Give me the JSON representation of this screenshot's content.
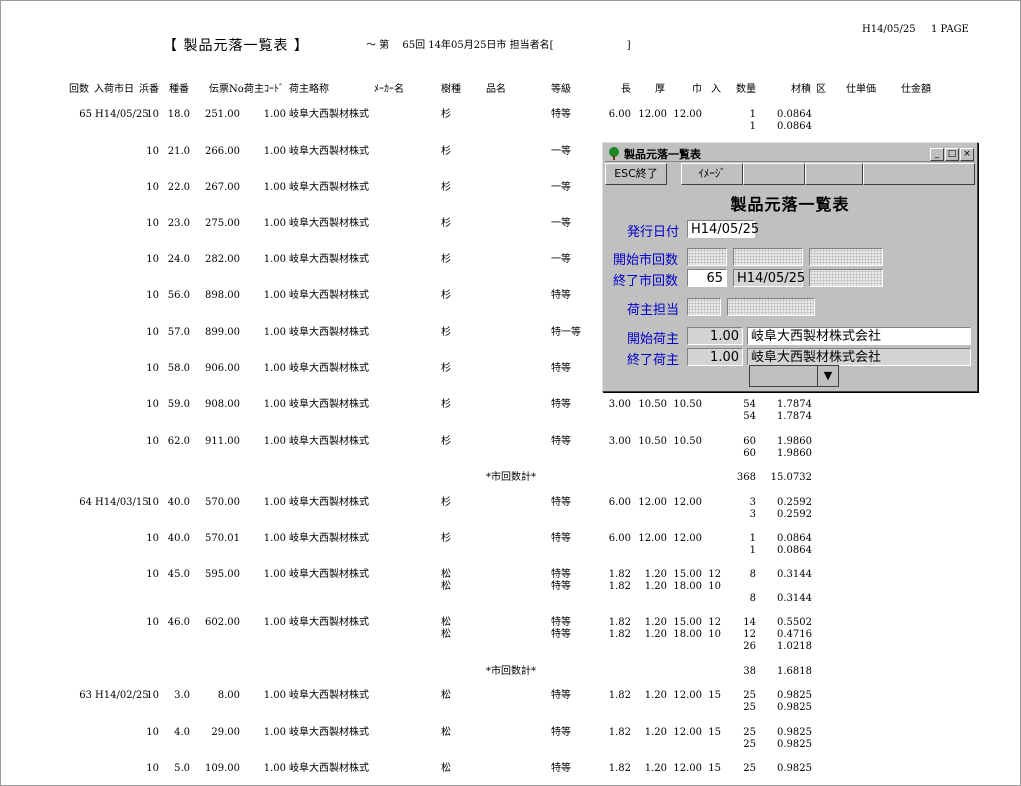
{
  "report": {
    "title": "【 製品元落一覧表 】",
    "header_line": "～ 第　 65回 14年05月25日市 担当者名[　　　　　　　 ]",
    "print_date": "H14/05/25",
    "page": "1 PAGE"
  },
  "columns": {
    "kaisu": "回数",
    "date": "入荷市日",
    "hama": "浜番",
    "shu": "種番",
    "denpyo": "伝票No.",
    "ninushi_cd": "荷主ｺｰﾄﾞ",
    "ninushi": "荷主略称",
    "maker": "ﾒｰｶｰ名",
    "jushu": "樹種",
    "hinmei": "品名",
    "tokyu": "等級",
    "naga": "長",
    "atsu": "厚",
    "haba": "巾",
    "iri": "入",
    "suryo": "数量",
    "zaiseki": "材積",
    "ku": "区",
    "tanka": "仕単価",
    "kingaku": "仕金額"
  },
  "rows": [
    {
      "kai": "65",
      "date": "H14/05/25",
      "hama": "10",
      "shu": "18.0",
      "den": "251.00",
      "cd": "1.00",
      "nin": "岐阜大西製材株式",
      "jushu": "杉",
      "tokyu": "特等",
      "naga": "6.00",
      "atsu": "12.00",
      "haba": "12.00",
      "iri": "",
      "sur": "1",
      "zai": "0.0864",
      "sur2": "1",
      "zai2": "0.0864"
    },
    {
      "kai": "",
      "date": "",
      "hama": "10",
      "shu": "21.0",
      "den": "266.00",
      "cd": "1.00",
      "nin": "岐阜大西製材株式",
      "jushu": "杉",
      "tokyu": "一等",
      "naga": "",
      "atsu": "",
      "haba": "",
      "iri": "",
      "sur": "",
      "zai": "",
      "sur2": "",
      "zai2": ""
    },
    {
      "kai": "",
      "date": "",
      "hama": "10",
      "shu": "22.0",
      "den": "267.00",
      "cd": "1.00",
      "nin": "岐阜大西製材株式",
      "jushu": "杉",
      "tokyu": "一等",
      "naga": "",
      "atsu": "",
      "haba": "",
      "iri": "",
      "sur": "",
      "zai": "",
      "sur2": "",
      "zai2": ""
    },
    {
      "kai": "",
      "date": "",
      "hama": "10",
      "shu": "23.0",
      "den": "275.00",
      "cd": "1.00",
      "nin": "岐阜大西製材株式",
      "jushu": "杉",
      "tokyu": "一等",
      "naga": "",
      "atsu": "",
      "haba": "",
      "iri": "",
      "sur": "",
      "zai": "",
      "sur2": "",
      "zai2": ""
    },
    {
      "kai": "",
      "date": "",
      "hama": "10",
      "shu": "24.0",
      "den": "282.00",
      "cd": "1.00",
      "nin": "岐阜大西製材株式",
      "jushu": "杉",
      "tokyu": "一等",
      "naga": "",
      "atsu": "",
      "haba": "",
      "iri": "",
      "sur": "",
      "zai": "",
      "sur2": "",
      "zai2": ""
    },
    {
      "kai": "",
      "date": "",
      "hama": "10",
      "shu": "56.0",
      "den": "898.00",
      "cd": "1.00",
      "nin": "岐阜大西製材株式",
      "jushu": "杉",
      "tokyu": "特等",
      "naga": "",
      "atsu": "",
      "haba": "",
      "iri": "",
      "sur": "",
      "zai": "",
      "sur2": "",
      "zai2": ""
    },
    {
      "kai": "",
      "date": "",
      "hama": "10",
      "shu": "57.0",
      "den": "899.00",
      "cd": "1.00",
      "nin": "岐阜大西製材株式",
      "jushu": "杉",
      "tokyu": "特一等",
      "naga": "",
      "atsu": "",
      "haba": "",
      "iri": "",
      "sur": "",
      "zai": "",
      "sur2": "",
      "zai2": ""
    },
    {
      "kai": "",
      "date": "",
      "hama": "10",
      "shu": "58.0",
      "den": "906.00",
      "cd": "1.00",
      "nin": "岐阜大西製材株式",
      "jushu": "杉",
      "tokyu": "特等",
      "naga": "",
      "atsu": "",
      "haba": "",
      "iri": "",
      "sur": "",
      "zai": "",
      "sur2": "",
      "zai2": ""
    },
    {
      "kai": "",
      "date": "",
      "hama": "10",
      "shu": "59.0",
      "den": "908.00",
      "cd": "1.00",
      "nin": "岐阜大西製材株式",
      "jushu": "杉",
      "tokyu": "特等",
      "naga": "3.00",
      "atsu": "10.50",
      "haba": "10.50",
      "iri": "",
      "sur": "54",
      "zai": "1.7874",
      "sur2": "54",
      "zai2": "1.7874"
    },
    {
      "kai": "",
      "date": "",
      "hama": "10",
      "shu": "62.0",
      "den": "911.00",
      "cd": "1.00",
      "nin": "岐阜大西製材株式",
      "jushu": "杉",
      "tokyu": "特等",
      "naga": "3.00",
      "atsu": "10.50",
      "haba": "10.50",
      "iri": "",
      "sur": "60",
      "zai": "1.9860",
      "sur2": "60",
      "zai2": "1.9860"
    },
    {
      "kai": "64",
      "date": "H14/03/15",
      "hama": "10",
      "shu": "40.0",
      "den": "570.00",
      "cd": "1.00",
      "nin": "岐阜大西製材株式",
      "jushu": "杉",
      "tokyu": "特等",
      "naga": "6.00",
      "atsu": "12.00",
      "haba": "12.00",
      "iri": "",
      "sur": "3",
      "zai": "0.2592",
      "sur2": "3",
      "zai2": "0.2592"
    },
    {
      "kai": "",
      "date": "",
      "hama": "10",
      "shu": "40.0",
      "den": "570.01",
      "cd": "1.00",
      "nin": "岐阜大西製材株式",
      "jushu": "杉",
      "tokyu": "特等",
      "naga": "6.00",
      "atsu": "12.00",
      "haba": "12.00",
      "iri": "",
      "sur": "1",
      "zai": "0.0864",
      "sur2": "1",
      "zai2": "0.0864"
    },
    {
      "kai": "",
      "date": "",
      "hama": "10",
      "shu": "45.0",
      "den": "595.00",
      "cd": "1.00",
      "nin": "岐阜大西製材株式",
      "jushu": "松",
      "tokyu": "特等",
      "naga": "1.82",
      "atsu": "1.20",
      "haba": "15.00",
      "iri": "12",
      "sur": "8",
      "zai": "0.3144",
      "sur2": "",
      "zai2": ""
    },
    {
      "kai": "",
      "date": "",
      "hama": "10",
      "shu": "46.0",
      "den": "602.00",
      "cd": "1.00",
      "nin": "岐阜大西製材株式",
      "jushu": "松",
      "tokyu": "特等",
      "naga": "1.82",
      "atsu": "1.20",
      "haba": "15.00",
      "iri": "12",
      "sur": "14",
      "zai": "0.5502",
      "sur2": "",
      "zai2": ""
    },
    {
      "kai": "63",
      "date": "H14/02/25",
      "hama": "10",
      "shu": "3.0",
      "den": "8.00",
      "cd": "1.00",
      "nin": "岐阜大西製材株式",
      "jushu": "松",
      "tokyu": "特等",
      "naga": "1.82",
      "atsu": "1.20",
      "haba": "12.00",
      "iri": "15",
      "sur": "25",
      "zai": "0.9825",
      "sur2": "25",
      "zai2": "0.9825"
    },
    {
      "kai": "",
      "date": "",
      "hama": "10",
      "shu": "4.0",
      "den": "29.00",
      "cd": "1.00",
      "nin": "岐阜大西製材株式",
      "jushu": "松",
      "tokyu": "特等",
      "naga": "1.82",
      "atsu": "1.20",
      "haba": "12.00",
      "iri": "15",
      "sur": "25",
      "zai": "0.9825",
      "sur2": "25",
      "zai2": "0.9825"
    },
    {
      "kai": "",
      "date": "",
      "hama": "10",
      "shu": "5.0",
      "den": "109.00",
      "cd": "1.00",
      "nin": "岐阜大西製材株式",
      "jushu": "松",
      "tokyu": "特等",
      "naga": "1.82",
      "atsu": "1.20",
      "haba": "12.00",
      "iri": "15",
      "sur": "25",
      "zai": "0.9825",
      "sur2": "",
      "zai2": ""
    }
  ],
  "extra_lines": [
    {
      "jushu": "松",
      "tokyu": "特等",
      "naga": "1.82",
      "atsu": "1.20",
      "haba": "18.00",
      "iri": "10",
      "sur": "",
      "zai": ""
    },
    {
      "sur": "8",
      "zai": "0.3144"
    },
    {
      "jushu": "松",
      "tokyu": "特等",
      "naga": "1.82",
      "atsu": "1.20",
      "haba": "18.00",
      "iri": "10",
      "sur": "12",
      "zai": "0.4716"
    },
    {
      "sur": "26",
      "zai": "1.0218"
    }
  ],
  "subtotals": [
    {
      "label": "*市回数計*",
      "sur": "368",
      "zai": "15.0732"
    },
    {
      "label": "*市回数計*",
      "sur": "38",
      "zai": "1.6818"
    }
  ],
  "dialog": {
    "title": "製品元落一覧表",
    "esc_button": "ESC終了",
    "image_button": "ｲﾒｰｼﾞ",
    "heading": "製品元落一覧表",
    "issue_date_label": "発行日付",
    "issue_date_value": "H14/05/25",
    "start_round_label": "開始市回数",
    "end_round_label": "終了市回数",
    "end_round_num": "65",
    "end_round_date": "H14/05/25",
    "shipper_staff_label": "荷主担当",
    "start_shipper_label": "開始荷主",
    "start_shipper_code": "1.00",
    "start_shipper_name": "岐阜大西製材株式会社",
    "end_shipper_label": "終了荷主",
    "end_shipper_code": "1.00",
    "end_shipper_name": "岐阜大西製材株式会社",
    "win_min": "_",
    "win_max": "□",
    "win_close": "×"
  }
}
